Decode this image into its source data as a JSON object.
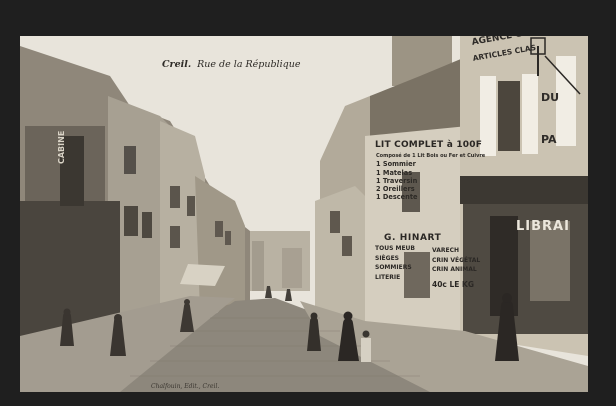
{
  "postcard": {
    "caption_place": "Creil.",
    "caption_street": "Rue de la République",
    "publisher": "Chalfouin, Edit., Creil."
  },
  "signs": {
    "lit_complet_title": "LIT COMPLET à 100F",
    "lit_complet_lines": [
      "Composé de 1 Lit Bois ou Fer et Cuivre",
      "1 Sommier",
      "1 Matelas",
      "1 Traversin",
      "2 Oreillers",
      "1 Descente"
    ],
    "hinart": "G. HINART",
    "hinart_left": [
      "TOUS MEUB",
      "SIÈGES",
      "SOMMIERS",
      "LITERIE"
    ],
    "hinart_right": [
      "VARECH",
      "CRIN VÉGÉTAL",
      "CRIN ANIMAL"
    ],
    "hinart_price": "40c LE KG",
    "librairie": "LIBRAI",
    "agence": "AGENCE GÉNÉ",
    "articles": "ARTICLES CLAS",
    "du": "DU",
    "pa": "PA",
    "cabinet": "CABINE"
  },
  "colors": {
    "sky": "#e9e6df",
    "border": "#1f1f1f",
    "wall": "#cfc8b8",
    "cobbles": "#8e887d"
  }
}
